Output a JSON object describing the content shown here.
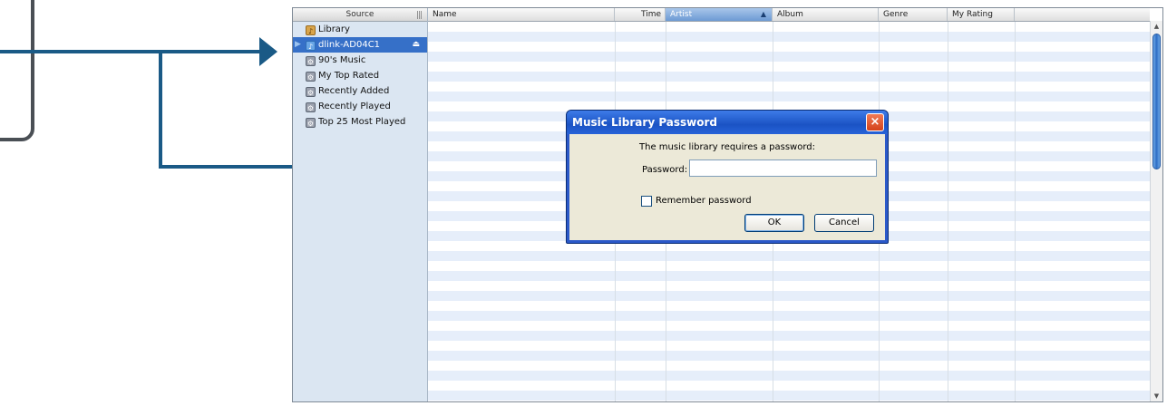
{
  "sidebar": {
    "header": "Source",
    "items": [
      {
        "label": "Library",
        "icon": "library-icon"
      },
      {
        "label": "dlink-AD04C1",
        "icon": "shared-library-icon",
        "selected": true
      },
      {
        "label": "90's Music",
        "icon": "smart-playlist-icon"
      },
      {
        "label": "My Top Rated",
        "icon": "smart-playlist-icon"
      },
      {
        "label": "Recently Added",
        "icon": "smart-playlist-icon"
      },
      {
        "label": "Recently Played",
        "icon": "smart-playlist-icon"
      },
      {
        "label": "Top 25 Most Played",
        "icon": "smart-playlist-icon"
      }
    ]
  },
  "columns": [
    {
      "label": "Name"
    },
    {
      "label": "Time"
    },
    {
      "label": "Artist",
      "sorted": true
    },
    {
      "label": "Album"
    },
    {
      "label": "Genre"
    },
    {
      "label": "My Rating"
    }
  ],
  "dialog": {
    "title": "Music Library Password",
    "message": "The music library requires a password:",
    "password_label": "Password:",
    "password_value": "",
    "remember_label": "Remember password",
    "ok_label": "OK",
    "cancel_label": "Cancel"
  },
  "colors": {
    "arrow": "#1a5a86",
    "selection": "#3670c8",
    "dialog_title": "#2b59c9"
  }
}
